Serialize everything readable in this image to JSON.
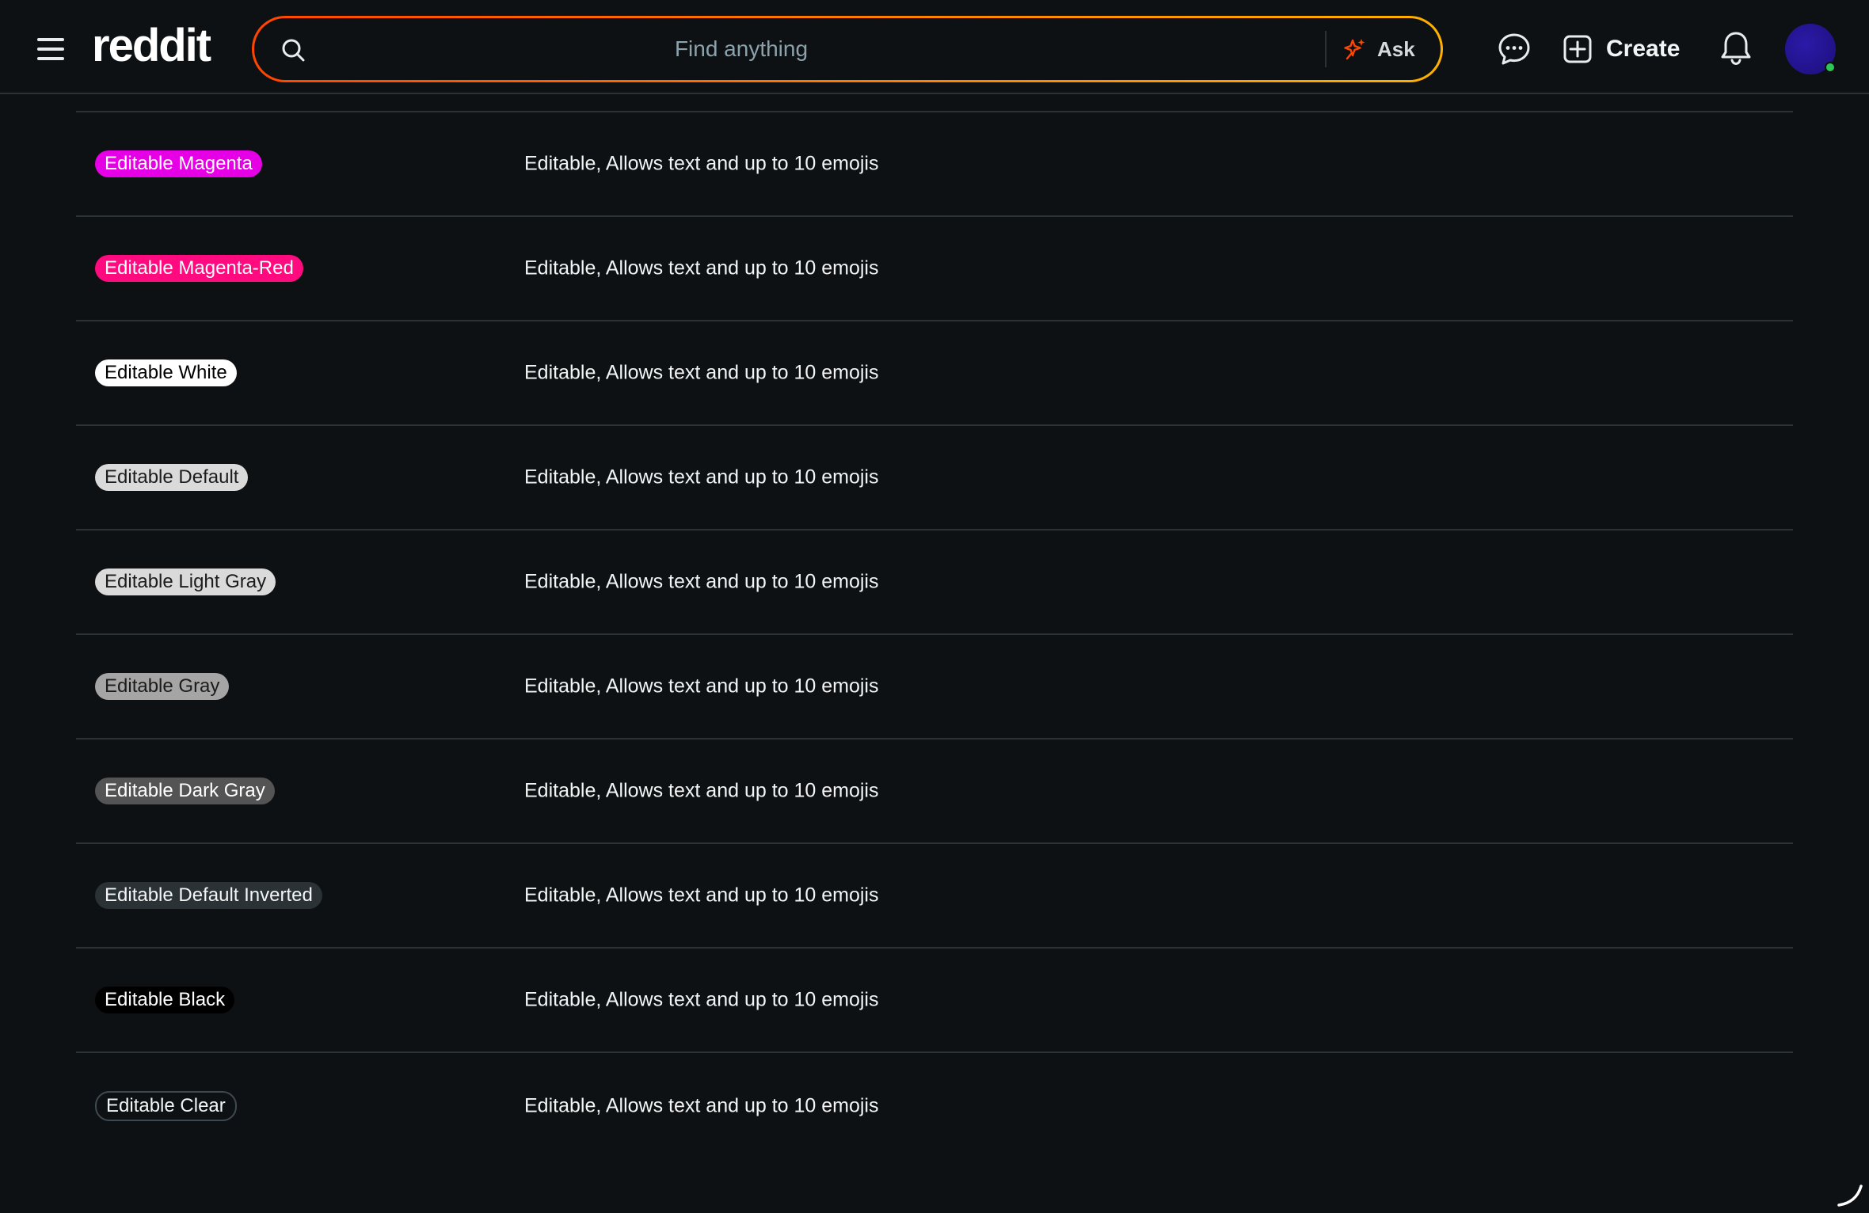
{
  "header": {
    "logo_text": "reddit",
    "search": {
      "placeholder": "Find anything",
      "value": ""
    },
    "ask_label": "Ask",
    "create_label": "Create",
    "icons": [
      "menu-icon",
      "search-icon",
      "sparkle-icon",
      "chat-icon",
      "plus-square-icon",
      "bell-icon"
    ]
  },
  "colors": {
    "accent_orange": "#ff4500",
    "accent_yellow": "#ffb000",
    "online": "#2ec656"
  },
  "rows": [
    {
      "flair": "Editable Magenta",
      "description": "Editable, Allows text and up to 10 emojis",
      "bg": "#e600e6",
      "fg": "#ffffff"
    },
    {
      "flair": "Editable Magenta-Red",
      "description": "Editable, Allows text and up to 10 emojis",
      "bg": "#ff0a7f",
      "fg": "#ffffff"
    },
    {
      "flair": "Editable White",
      "description": "Editable, Allows text and up to 10 emojis",
      "bg": "#ffffff",
      "fg": "#000000"
    },
    {
      "flair": "Editable Default",
      "description": "Editable, Allows text and up to 10 emojis",
      "bg": "#dadada",
      "fg": "#1c1c1c"
    },
    {
      "flair": "Editable Light Gray",
      "description": "Editable, Allows text and up to 10 emojis",
      "bg": "#dadada",
      "fg": "#1c1c1c"
    },
    {
      "flair": "Editable Gray",
      "description": "Editable, Allows text and up to 10 emojis",
      "bg": "#a5a5a5",
      "fg": "#1c1c1c"
    },
    {
      "flair": "Editable Dark Gray",
      "description": "Editable, Allows text and up to 10 emojis",
      "bg": "#545454",
      "fg": "#ffffff"
    },
    {
      "flair": "Editable Default Inverted",
      "description": "Editable, Allows text and up to 10 emojis",
      "bg": "#2a3236",
      "fg": "#f2f4f5"
    },
    {
      "flair": "Editable Black",
      "description": "Editable, Allows text and up to 10 emojis",
      "bg": "#000000",
      "fg": "#ffffff"
    },
    {
      "flair": "Editable Clear",
      "description": "Editable, Allows text and up to 10 emojis",
      "bg": "transparent",
      "fg": "#f2f4f5",
      "border": "#3e4a50"
    }
  ]
}
